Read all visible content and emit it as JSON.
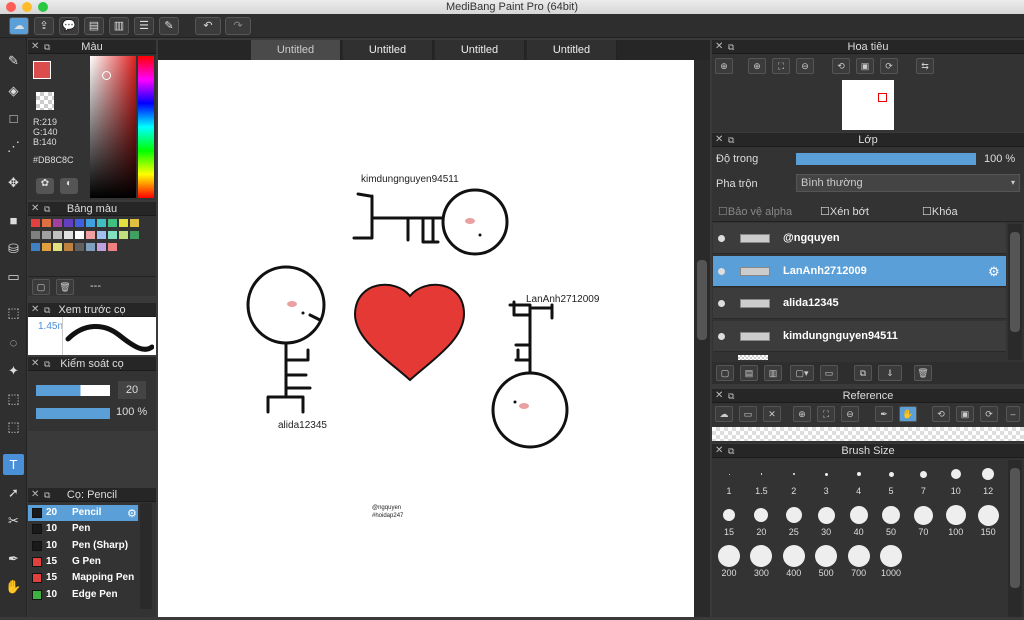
{
  "app": {
    "title": "MediBang Paint Pro (64bit)"
  },
  "tabs": [
    "Untitled",
    "Untitled",
    "Untitled",
    "Untitled"
  ],
  "color_panel": {
    "title": "Màu",
    "r": "R:219",
    "g": "G:140",
    "b": "B:140",
    "hex": "#DB8C8C",
    "main_color": "#DB4C4C"
  },
  "palette_panel": {
    "title": "Bảng màu",
    "footer": "---"
  },
  "preview_panel": {
    "title": "Xem trước cọ",
    "value": "1.45n"
  },
  "control_panel": {
    "title": "Kiểm soát cọ",
    "size": "20",
    "opacity": "100 %"
  },
  "brush_panel": {
    "title": "Cọ: Pencil",
    "items": [
      {
        "size": "20",
        "name": "Pencil",
        "color": "#1a1a1a"
      },
      {
        "size": "10",
        "name": "Pen",
        "color": "#1a1a1a"
      },
      {
        "size": "10",
        "name": "Pen (Sharp)",
        "color": "#1a1a1a"
      },
      {
        "size": "15",
        "name": "G Pen",
        "color": "#e04040"
      },
      {
        "size": "15",
        "name": "Mapping Pen",
        "color": "#e04040"
      },
      {
        "size": "10",
        "name": "Edge Pen",
        "color": "#40b040"
      }
    ]
  },
  "canvas": {
    "label_top": "kimdungnguyen94511",
    "label_right": "LanAnh2712009",
    "label_left": "alida12345",
    "sig1": "@ngquyen",
    "sig2": "#hoidap247"
  },
  "navigator_panel": {
    "title": "Hoa tiêu"
  },
  "layer_panel": {
    "title": "Lớp",
    "opacity_label": "Độ trong",
    "opacity_value": "100 %",
    "blend_label": "Pha trộn",
    "blend_value": "Bình thường",
    "protect_alpha": "Bảo vệ alpha",
    "clipping": "Xén bớt",
    "lock": "Khóa",
    "layers": [
      "@ngquyen",
      "LanAnh2712009",
      "alida12345",
      "kimdungnguyen94511"
    ]
  },
  "reference_panel": {
    "title": "Reference"
  },
  "brushsize_panel": {
    "title": "Brush Size",
    "sizes": [
      "1",
      "1.5",
      "2",
      "3",
      "4",
      "5",
      "7",
      "10",
      "12",
      "15",
      "20",
      "25",
      "30",
      "40",
      "50",
      "70",
      "100",
      "150",
      "200",
      "300",
      "400",
      "500",
      "700",
      "1000"
    ]
  }
}
